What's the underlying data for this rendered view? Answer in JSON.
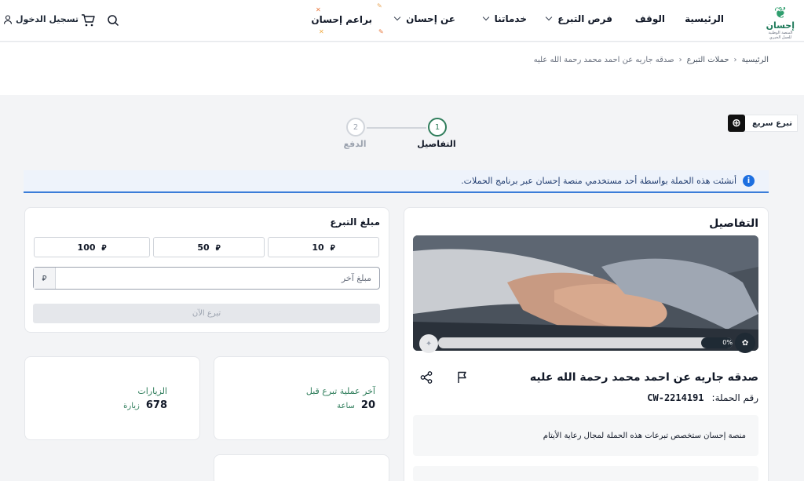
{
  "header": {
    "logo_name": "إحسان",
    "logo_tagline": "المنصة الوطنية للعمل الخيري",
    "nav": {
      "home": "الرئيسية",
      "waqf": "الوقف",
      "donation_opportunities": "فرص التبرع",
      "services": "خدماتنا",
      "about": "عن إحسان",
      "ehsan_programs": "براعم إحسان"
    },
    "login_label": "تسجيل الدخول"
  },
  "breadcrumb": {
    "home": "الرئيسية",
    "campaigns": "حملات التبرع",
    "current": "صدقه جاريه عن احمد محمد رحمة الله عليه"
  },
  "quick_donate_label": "تبرع سريع",
  "stepper": {
    "step1_num": "1",
    "step1_label": "التفاصيل",
    "step2_num": "2",
    "step2_label": "الدفع"
  },
  "info_banner": "أنشئت هذه الحملة بواسطة أحد مستخدمي منصة إحسان عبر برنامج الحملات.",
  "details": {
    "title": "التفاصيل",
    "progress_label": "0%",
    "progress_fraction": 0,
    "campaign_title": "صدقه جاريه عن احمد محمد رحمة الله عليه",
    "campaign_number_label": "رقم الحملة:",
    "campaign_number": "CW-2214191",
    "description": "منصة إحسان ستخصص تبرعات هذه الحملة لمجال رعاية الأيتام"
  },
  "donation": {
    "title": "مبلغ التبرع",
    "currency_symbol": "⃁",
    "amounts": [
      "10",
      "50",
      "100"
    ],
    "other_placeholder": "مبلغ آخر",
    "donate_button": "تبرع الآن"
  },
  "stats": {
    "last_donation_label": "آخر عملية تبرع قبل",
    "last_donation_value": "20",
    "last_donation_unit": "ساعة",
    "visits_label": "الزيارات",
    "visits_value": "678",
    "visits_unit": "زيارة"
  },
  "colors": {
    "brand_green": "#2f7d5b",
    "info_blue": "#1d6fe0"
  }
}
